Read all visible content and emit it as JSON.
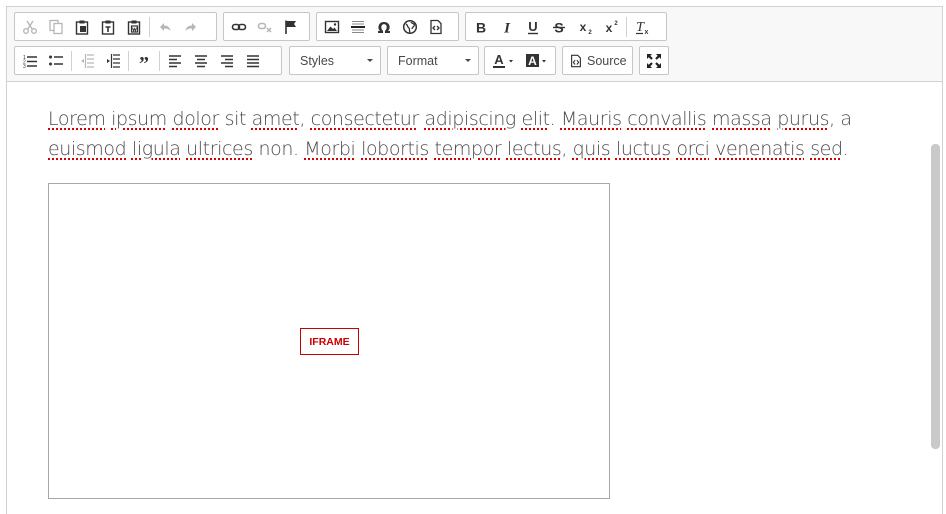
{
  "toolbar": {
    "styles_label": "Styles",
    "format_label": "Format",
    "source_label": "Source"
  },
  "content": {
    "paragraph": [
      {
        "w": "Lorem",
        "s": true
      },
      {
        "w": " "
      },
      {
        "w": "ipsum",
        "s": true
      },
      {
        "w": " "
      },
      {
        "w": "dolor",
        "s": true
      },
      {
        "w": " sit "
      },
      {
        "w": "amet",
        "s": true
      },
      {
        "w": ", "
      },
      {
        "w": "consectetur",
        "s": true
      },
      {
        "w": " "
      },
      {
        "w": "adipiscing",
        "s": true
      },
      {
        "w": " "
      },
      {
        "w": "elit",
        "s": true
      },
      {
        "w": ". "
      },
      {
        "w": "Mauris",
        "s": true
      },
      {
        "w": " "
      },
      {
        "w": "convallis",
        "s": true
      },
      {
        "w": " "
      },
      {
        "w": "massa",
        "s": true
      },
      {
        "w": " "
      },
      {
        "w": "purus",
        "s": true
      },
      {
        "w": ", a "
      },
      {
        "w": "euismod",
        "s": true
      },
      {
        "w": " "
      },
      {
        "w": "ligula",
        "s": true
      },
      {
        "w": " "
      },
      {
        "w": "ultrices",
        "s": true
      },
      {
        "w": " non. "
      },
      {
        "w": "Morbi",
        "s": true
      },
      {
        "w": " "
      },
      {
        "w": "lobortis",
        "s": true
      },
      {
        "w": " "
      },
      {
        "w": "tempor",
        "s": true
      },
      {
        "w": " "
      },
      {
        "w": "lectus",
        "s": true
      },
      {
        "w": ", "
      },
      {
        "w": "quis",
        "s": true
      },
      {
        "w": " "
      },
      {
        "w": "luctus",
        "s": true
      },
      {
        "w": " "
      },
      {
        "w": "orci",
        "s": true
      },
      {
        "w": " "
      },
      {
        "w": "venenatis",
        "s": true
      },
      {
        "w": " "
      },
      {
        "w": "sed",
        "s": true
      },
      {
        "w": "."
      }
    ],
    "iframe_label": "IFRAME"
  },
  "colors": {
    "spellcheck": "#d40000",
    "iframe_label": "#c80000",
    "toolbar_bg": "#f8f8f8"
  }
}
